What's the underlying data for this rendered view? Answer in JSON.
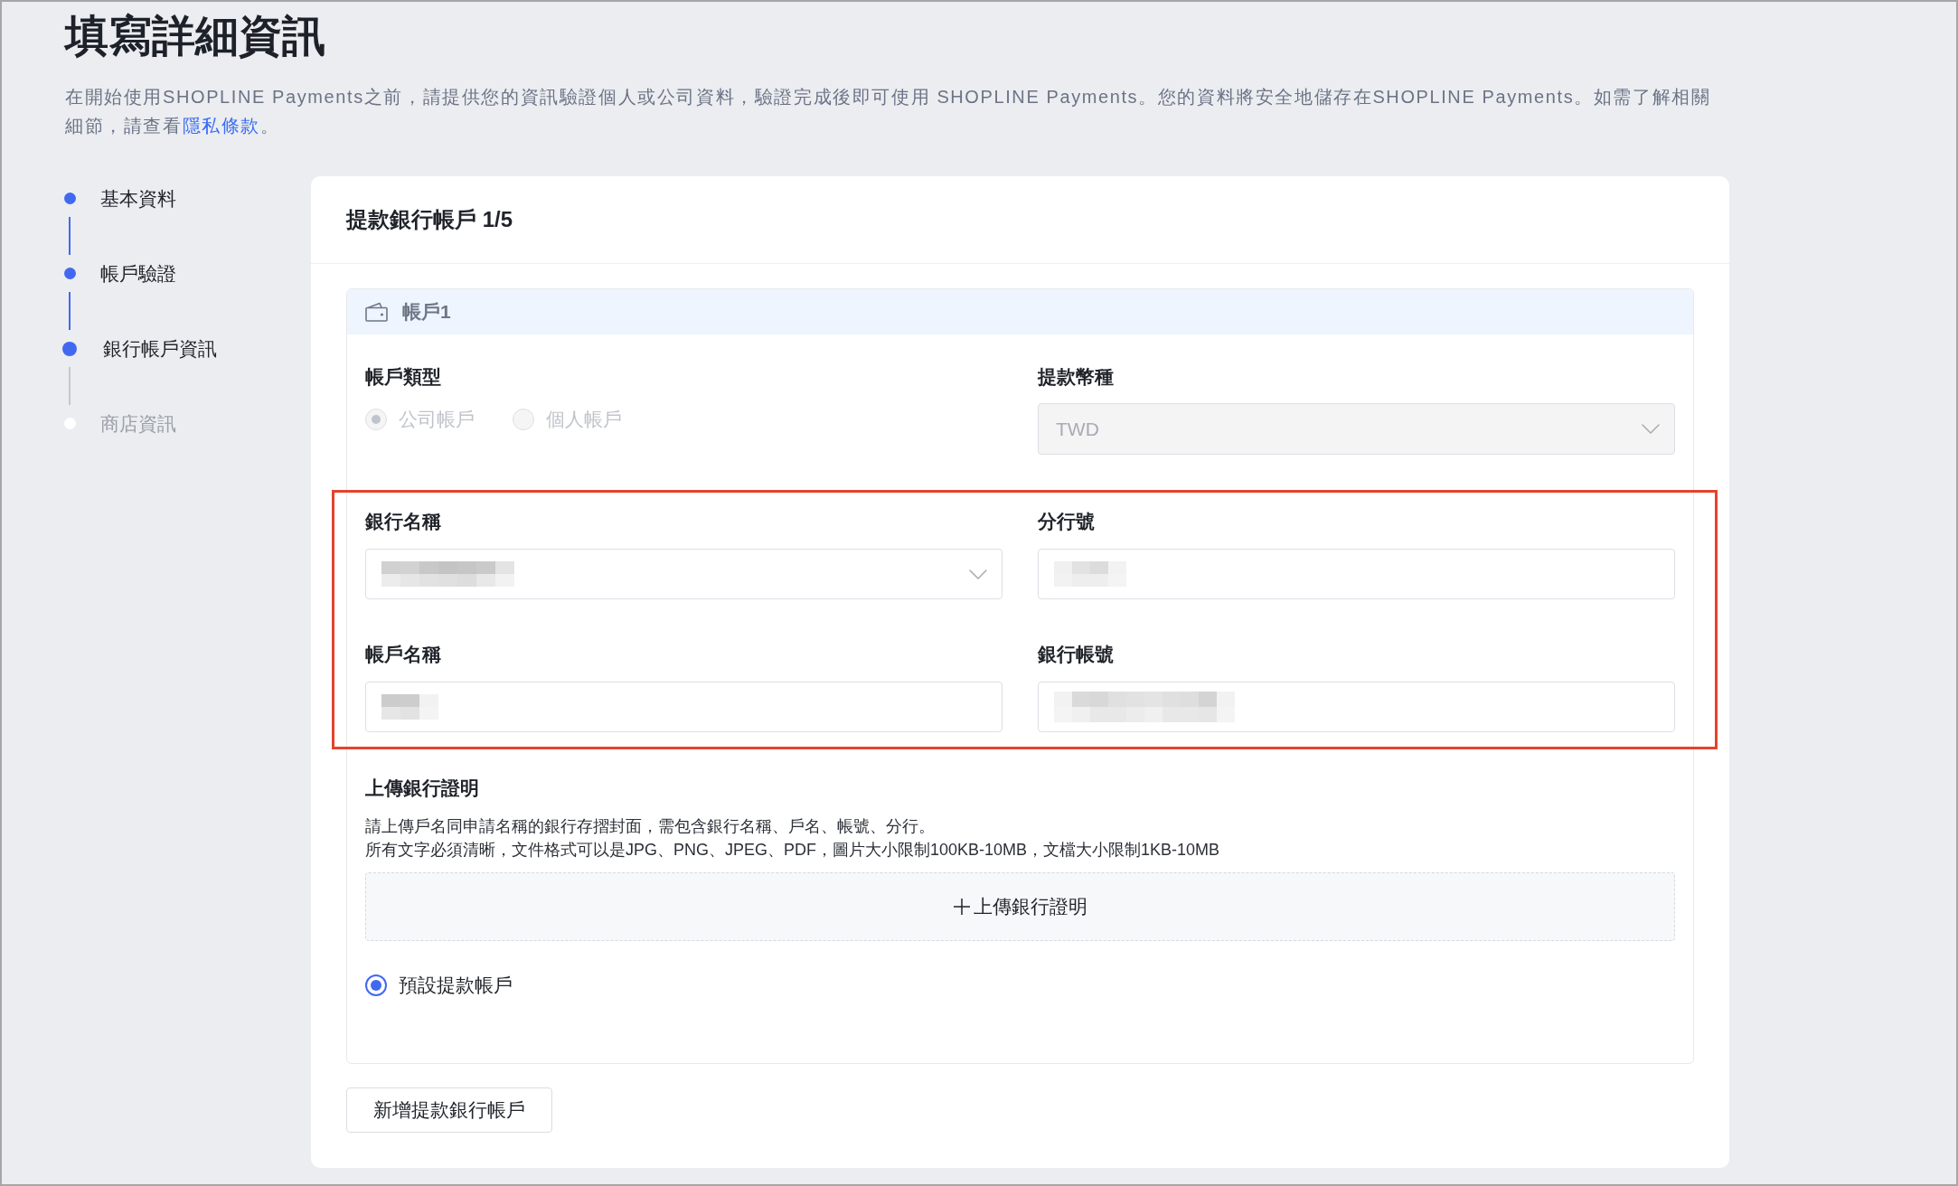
{
  "page": {
    "title": "填寫詳細資訊",
    "intro": {
      "text": "在開始使用SHOPLINE Payments之前，請提供您的資訊驗證個人或公司資料，驗證完成後即可使用 SHOPLINE Payments。您的資料將安全地儲存在SHOPLINE Payments。如需了解相關細節，請查看",
      "link": "隱私條款",
      "text_end": "。"
    }
  },
  "steps": [
    {
      "label": "基本資料",
      "reached": true,
      "selected": false
    },
    {
      "label": "帳戶驗證",
      "reached": true,
      "selected": false
    },
    {
      "label": "銀行帳戶資訊",
      "reached": true,
      "selected": true
    },
    {
      "label": "商店資訊",
      "reached": false,
      "selected": false
    }
  ],
  "card": {
    "title": "提款銀行帳戶 1/5",
    "accounts": [
      {
        "title": "帳戶1",
        "account_type": {
          "label": "帳戶類型",
          "disabled": true,
          "options": [
            {
              "label": "公司帳戶",
              "selected": true
            },
            {
              "label": "個人帳戶",
              "selected": false
            }
          ]
        },
        "currency": {
          "label": "提款幣種",
          "value": "TWD",
          "disabled": true
        },
        "bank_details": {
          "highlighted": true,
          "fields": [
            {
              "label": "銀行名稱",
              "kind": "select",
              "redacted": true
            },
            {
              "label": "分行號",
              "kind": "input",
              "redacted": true
            },
            {
              "label": "帳戶名稱",
              "kind": "input",
              "redacted": true
            },
            {
              "label": "銀行帳號",
              "kind": "input",
              "redacted": true
            }
          ]
        },
        "upload": {
          "label": "上傳銀行證明",
          "hint_lines": [
            "請上傳戶名同申請名稱的銀行存摺封面，需包含銀行名稱、戶名、帳號、分行。",
            "所有文字必須清晰，文件格式可以是JPG、PNG、JPEG、PDF，圖片大小限制100KB-10MB，文檔大小限制1KB-10MB"
          ],
          "button": "上傳銀行證明"
        },
        "default_account": {
          "label": "預設提款帳戶",
          "selected": true
        }
      }
    ],
    "add_button": "新增提款銀行帳戶"
  }
}
